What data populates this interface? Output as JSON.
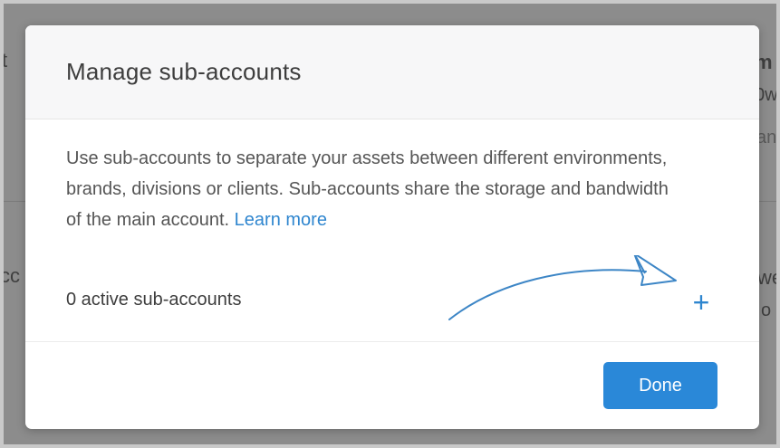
{
  "background": {
    "left_top": "t",
    "left_mid": "cc",
    "right_top": "m",
    "right_second": "0w",
    "right_third": "ans",
    "right_mid": "we",
    "right_mid2": "o"
  },
  "modal": {
    "title": "Manage sub-accounts",
    "description": "Use sub-accounts to separate your assets between different environments, brands, divisions or clients. Sub-accounts share the storage and bandwidth of the main account.",
    "learn_more": "Learn more",
    "count_text": "0 active sub-accounts",
    "add_symbol": "+",
    "done_label": "Done"
  },
  "colors": {
    "accent": "#2a88d8",
    "link": "#2f86cf",
    "overlay": "#8c8c8c"
  }
}
